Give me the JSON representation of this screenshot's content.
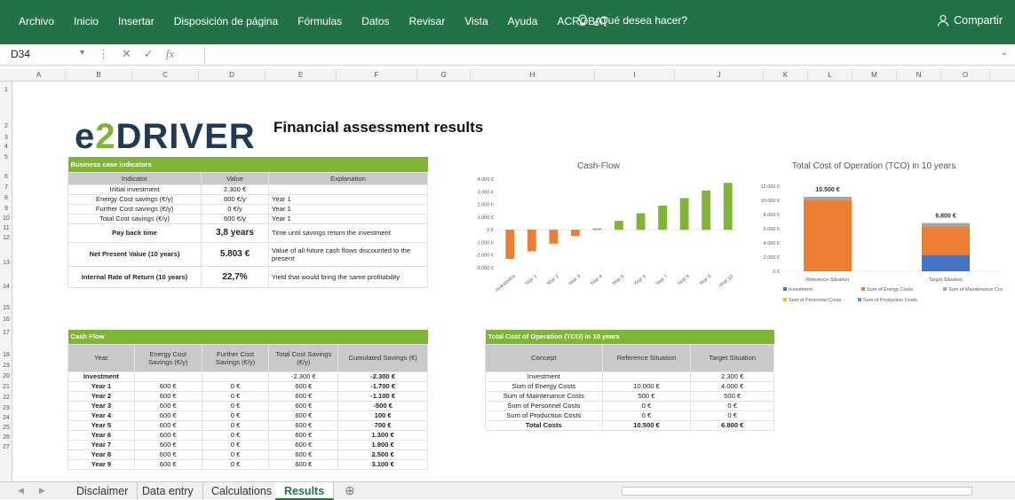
{
  "ribbon": {
    "tabs": [
      "Archivo",
      "Inicio",
      "Insertar",
      "Disposición de página",
      "Fórmulas",
      "Datos",
      "Revisar",
      "Vista",
      "Ayuda",
      "ACROBAT"
    ],
    "tell_me": "¿Qué desea hacer?",
    "share": "Compartir"
  },
  "formula_bar": {
    "name_box": "D34",
    "fx": "fx"
  },
  "columns": [
    "A",
    "B",
    "C",
    "D",
    "E",
    "F",
    "G",
    "H",
    "I",
    "J",
    "K",
    "L",
    "M",
    "N",
    "O"
  ],
  "rows": [
    "1",
    "2",
    "3",
    "4",
    "5",
    "6",
    "7",
    "8",
    "9",
    "10",
    "11",
    "12",
    "13",
    "14",
    "15",
    "16",
    "17",
    "18",
    "19",
    "20",
    "21",
    "22",
    "23",
    "24",
    "25",
    "26",
    "27"
  ],
  "logo": {
    "e": "e",
    "two": "2",
    "rest": "DRIVER"
  },
  "title": "Financial assessment results",
  "bci": {
    "header": "Business case indicators",
    "cols": [
      "Indicator",
      "Value",
      "Explanation"
    ],
    "rows": [
      [
        "Initial investment",
        "2.300 €",
        ""
      ],
      [
        "Energy Cost savings (€/y)",
        "600 €/y",
        "Year 1"
      ],
      [
        "Further Cost savings (€/y)",
        "0 €/y",
        "Year 1"
      ],
      [
        "Total Cost savings (€/y)",
        "600 €/y",
        "Year 1"
      ]
    ],
    "big": [
      [
        "Pay back time",
        "3,8 years",
        "Time until savings return the investment"
      ],
      [
        "Net Present Value (10 years)",
        "5.803 €",
        "Value of all future cash flows discounted to the present"
      ],
      [
        "Internal Rate of Return (10 years)",
        "22,7%",
        "Yield that would bring the same profitability"
      ]
    ]
  },
  "cashflow": {
    "header": "Cash Flow",
    "cols": [
      "Year",
      "Energy Cost Savings (€/y)",
      "Further Cost Savings (€/y)",
      "Total Cost Savings (€/y)",
      "Cumulated Savings (€)"
    ],
    "rows": [
      [
        "Investment",
        "",
        "",
        "-2.300 €",
        "-2.300 €"
      ],
      [
        "Year 1",
        "600 €",
        "0 €",
        "600 €",
        "-1.700 €"
      ],
      [
        "Year 2",
        "600 €",
        "0 €",
        "600 €",
        "-1.100 €"
      ],
      [
        "Year 3",
        "600 €",
        "0 €",
        "600 €",
        "-500 €"
      ],
      [
        "Year 4",
        "600 €",
        "0 €",
        "600 €",
        "100 €"
      ],
      [
        "Year 5",
        "600 €",
        "0 €",
        "600 €",
        "700 €"
      ],
      [
        "Year 6",
        "600 €",
        "0 €",
        "600 €",
        "1.300 €"
      ],
      [
        "Year 7",
        "600 €",
        "0 €",
        "600 €",
        "1.900 €"
      ],
      [
        "Year 8",
        "600 €",
        "0 €",
        "600 €",
        "2.500 €"
      ],
      [
        "Year 9",
        "600 €",
        "0 €",
        "600 €",
        "3.100 €"
      ]
    ]
  },
  "tco": {
    "header": "Total Cost of Operation (TCO) in 10 years",
    "cols": [
      "Concept",
      "Reference Situation",
      "Target Situation"
    ],
    "rows": [
      [
        "Investment",
        "",
        "2.300 €"
      ],
      [
        "Sum of Energy Costs",
        "10.000 €",
        "4.000 €"
      ],
      [
        "Sum of Maintenance Costs",
        "500 €",
        "500 €"
      ],
      [
        "Sum of Personnel Costs",
        "0 €",
        "0 €"
      ],
      [
        "Sum of Production Costs",
        "0 €",
        "0 €"
      ],
      [
        "Total Costs",
        "10.500 €",
        "6.800 €"
      ]
    ]
  },
  "sheet_tabs": [
    "Disclaimer",
    "Data entry",
    "Calculations",
    "Results"
  ],
  "colors": {
    "excel_green": "#217346",
    "header_green": "#7fb536",
    "orange": "#ed7d31",
    "blue": "#4472c4",
    "gray": "#a5a5a5",
    "yellow": "#ffc000"
  },
  "chart_data": [
    {
      "type": "bar",
      "title": "Cash-Flow",
      "categories": [
        "Investment",
        "Year 1",
        "Year 2",
        "Year 3",
        "Year 4",
        "Year 5",
        "Year 6",
        "Year 7",
        "Year 8",
        "Year 9",
        "Year 10"
      ],
      "series": [
        {
          "values": [
            -2300,
            -1700,
            -1100,
            -500,
            100,
            700,
            1300,
            1900,
            2500,
            3100,
            3700
          ]
        }
      ],
      "ylim": [
        -3000,
        4000
      ],
      "yticks": [
        "4.000 €",
        "3.000 €",
        "2.000 €",
        "1.000 €",
        "0 €",
        "-1.000 €",
        "-2.000 €",
        "-3.000 €"
      ],
      "grid": false
    },
    {
      "type": "bar",
      "title": "Total Cost of Operation (TCO) in 10 years",
      "categories": [
        "Reference Situation",
        "Target Situation"
      ],
      "series": [
        {
          "name": "Investment",
          "values": [
            0,
            2300
          ]
        },
        {
          "name": "Sum of Energy Costs",
          "values": [
            10000,
            4000
          ]
        },
        {
          "name": "Sum of Maintenance Costs",
          "values": [
            500,
            500
          ]
        },
        {
          "name": "Sum of Personnel Costs",
          "values": [
            0,
            0
          ]
        },
        {
          "name": "Sum of Production Costs",
          "values": [
            0,
            0
          ]
        }
      ],
      "totals": [
        "10.500 €",
        "6.800 €"
      ],
      "ylim": [
        0,
        12000
      ],
      "yticks": [
        "12.000 €",
        "10.000 €",
        "8.000 €",
        "6.000 €",
        "4.000 €",
        "2.000 €",
        "0 €"
      ],
      "legend": "bottom",
      "stacked": true
    }
  ]
}
